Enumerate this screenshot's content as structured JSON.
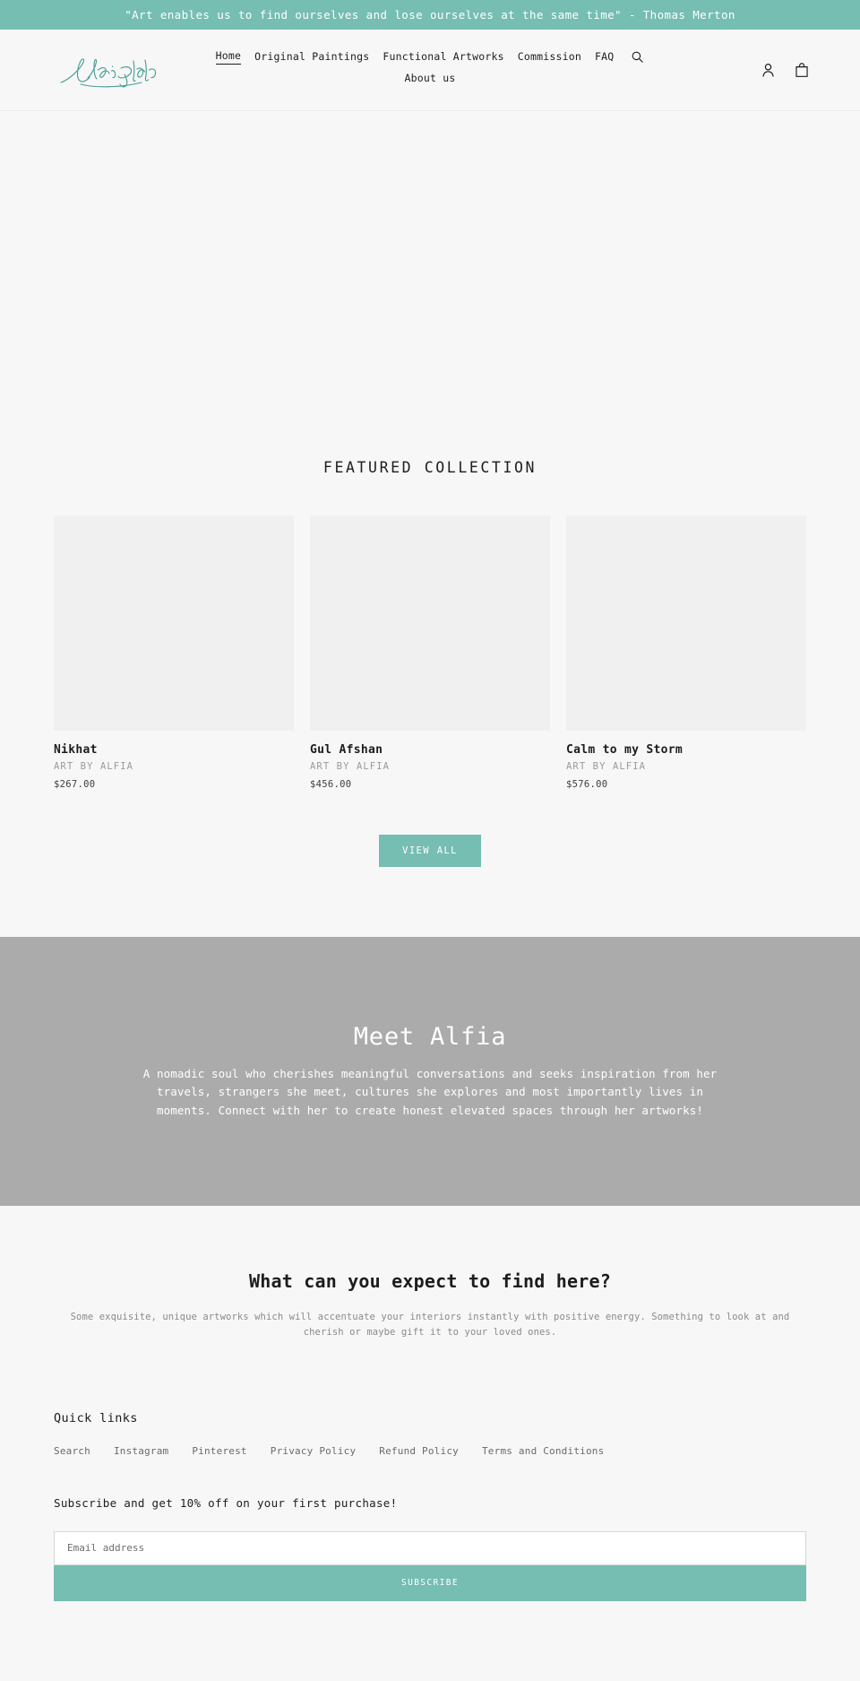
{
  "theme": {
    "accent": "#76bdb2",
    "page_bg": "#f7f7f7",
    "text": "#1c1d1d",
    "muted": "#9a9a9a",
    "meet_bg": "#ababab",
    "thumb_bg": "#f0f0f0"
  },
  "announcement": {
    "text": "\"Art enables us to find ourselves and lose ourselves at the same time\" - Thomas Merton"
  },
  "header": {
    "logo_text": "Alfia Iqbal",
    "nav_row1": [
      {
        "label": "Home",
        "active": true
      },
      {
        "label": "Original Paintings",
        "active": false
      },
      {
        "label": "Functional Artworks",
        "active": false
      },
      {
        "label": "Commission",
        "active": false
      },
      {
        "label": "FAQ",
        "active": false
      }
    ],
    "nav_row2": [
      {
        "label": "About us",
        "active": false
      }
    ],
    "search_icon": "search-icon",
    "account_icon": "account-icon",
    "cart_icon": "cart-icon"
  },
  "featured": {
    "title": "FEATURED COLLECTION",
    "products": [
      {
        "title": "Nikhat",
        "vendor": "ART BY ALFIA",
        "price": "$267.00"
      },
      {
        "title": "Gul Afshan",
        "vendor": "ART BY ALFIA",
        "price": "$456.00"
      },
      {
        "title": "Calm to my Storm",
        "vendor": "ART BY ALFIA",
        "price": "$576.00"
      }
    ],
    "view_all_label": "VIEW ALL"
  },
  "meet": {
    "title": "Meet Alfia",
    "body": "A nomadic soul who cherishes meaningful conversations and seeks inspiration from her travels, strangers she meet, cultures she explores and most importantly lives in moments. Connect with her to create honest elevated spaces through her artworks!"
  },
  "expect": {
    "title": "What can you expect to find here?",
    "body": "Some exquisite, unique artworks which will accentuate your interiors instantly with positive energy. Something to look at and cherish or maybe gift it to your loved ones."
  },
  "footer": {
    "quick_links_heading": "Quick links",
    "quick_links": [
      {
        "label": "Search"
      },
      {
        "label": "Instagram"
      },
      {
        "label": "Pinterest"
      },
      {
        "label": "Privacy Policy"
      },
      {
        "label": "Refund Policy"
      },
      {
        "label": "Terms and Conditions"
      }
    ],
    "newsletter_heading": "Subscribe and get 10% off on your first purchase!",
    "email_placeholder": "Email address",
    "email_value": "",
    "subscribe_label": "SUBSCRIBE"
  }
}
